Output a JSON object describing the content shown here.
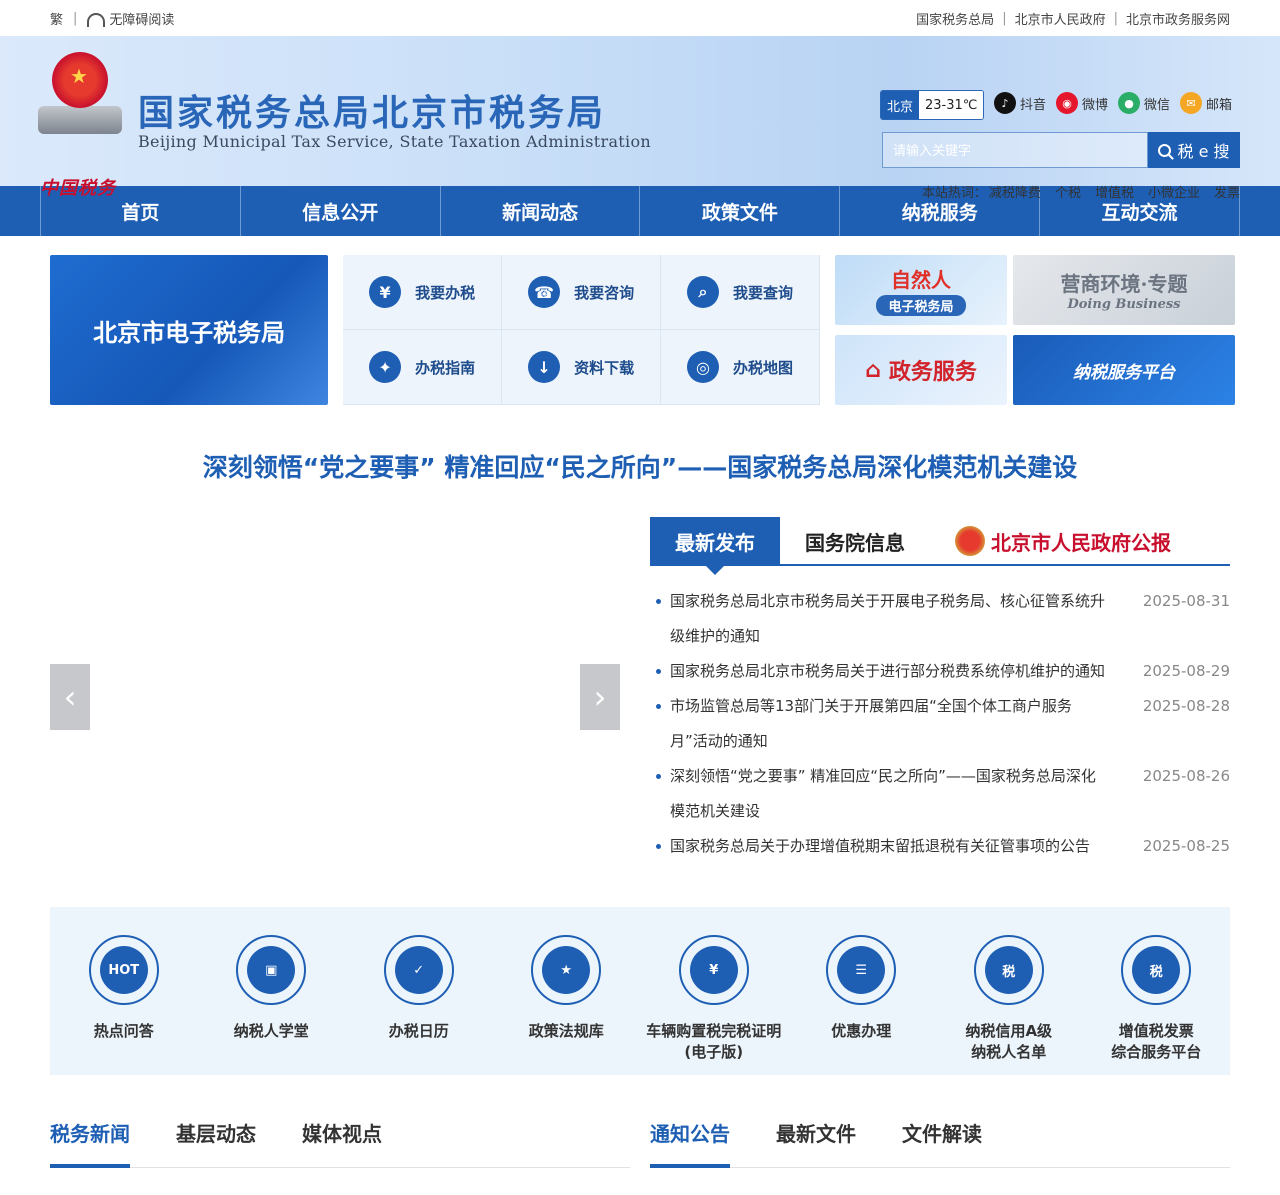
{
  "topbar": {
    "traditional": "繁",
    "accessible": "无障碍阅读",
    "links": [
      "国家税务总局",
      "北京市人民政府",
      "北京市政务服务网"
    ]
  },
  "header": {
    "seal_text": "中国税务",
    "title": "国家税务总局北京市税务局",
    "subtitle": "Beijing Municipal Tax Service, State Taxation Administration",
    "weather_city": "北京",
    "weather_temp": "23-31℃",
    "socials": [
      {
        "label": "抖音",
        "icon": "douyin-icon",
        "color": "#111111",
        "glyph": "♪"
      },
      {
        "label": "微博",
        "icon": "weibo-icon",
        "color": "#e6162d",
        "glyph": "◉"
      },
      {
        "label": "微信",
        "icon": "wechat-icon",
        "color": "#2aae67",
        "glyph": "●"
      },
      {
        "label": "邮箱",
        "icon": "mail-icon",
        "color": "#f5a623",
        "glyph": "✉"
      }
    ],
    "search_placeholder": "请输入关键字",
    "search_button": "税 e 搜",
    "hotwords_label": "本站热词：",
    "hotwords": [
      "减税降费",
      "个税",
      "增值税",
      "小微企业",
      "发票"
    ]
  },
  "nav": [
    "首页",
    "信息公开",
    "新闻动态",
    "政策文件",
    "纳税服务",
    "互动交流"
  ],
  "quick": {
    "etax": "北京市电子税务局",
    "grid": [
      {
        "label": "我要办税",
        "icon": "tax-handling-icon",
        "glyph": "¥"
      },
      {
        "label": "我要咨询",
        "icon": "headset-icon",
        "glyph": "☎"
      },
      {
        "label": "我要查询",
        "icon": "document-search-icon",
        "glyph": "⌕"
      },
      {
        "label": "办税指南",
        "icon": "compass-icon",
        "glyph": "✦"
      },
      {
        "label": "资料下载",
        "icon": "download-icon",
        "glyph": "↓"
      },
      {
        "label": "办税地图",
        "icon": "map-pin-icon",
        "glyph": "◎"
      }
    ],
    "banners": {
      "natural_person": "自然人",
      "natural_person_sub": "电子税务局",
      "business_env": "营商环境·专题",
      "business_env_en": "Doing Business",
      "gov_service": "政务服务",
      "tax_platform": "纳税服务平台"
    }
  },
  "headline": "深刻领悟“党之要事” 精准回应“民之所向”——国家税务总局深化模范机关建设",
  "slider": {
    "prev": "‹",
    "next": "›"
  },
  "news": {
    "tabs": [
      "最新发布",
      "国务院信息",
      "北京市人民政府公报"
    ],
    "items": [
      {
        "title": "国家税务总局北京市税务局关于开展电子税务局、核心征管系统升级维护的通知",
        "date": "2025-08-31"
      },
      {
        "title": "国家税务总局北京市税务局关于进行部分税费系统停机维护的通知",
        "date": "2025-08-29"
      },
      {
        "title": "市场监管总局等13部门关于开展第四届“全国个体工商户服务月”活动的通知",
        "date": "2025-08-28"
      },
      {
        "title": "深刻领悟“党之要事” 精准回应“民之所向”——国家税务总局深化模范机关建设",
        "date": "2025-08-26"
      },
      {
        "title": "国家税务总局关于办理增值税期末留抵退税有关征管事项的公告",
        "date": "2025-08-25"
      }
    ]
  },
  "services": [
    {
      "label": "热点问答",
      "icon": "hot-icon",
      "glyph": "HOT"
    },
    {
      "label": "纳税人学堂",
      "icon": "classroom-icon",
      "glyph": "▣"
    },
    {
      "label": "办税日历",
      "icon": "calendar-icon",
      "glyph": "✓"
    },
    {
      "label": "政策法规库",
      "icon": "law-book-icon",
      "glyph": "★"
    },
    {
      "label": "车辆购置税完税证明\n(电子版)",
      "icon": "car-tax-icon",
      "glyph": "¥"
    },
    {
      "label": "优惠办理",
      "icon": "discount-icon",
      "glyph": "☰"
    },
    {
      "label": "纳税信用A级\n纳税人名单",
      "icon": "credit-icon",
      "glyph": "税"
    },
    {
      "label": "增值税发票\n综合服务平台",
      "icon": "invoice-icon",
      "glyph": "税"
    }
  ],
  "bottom_tabs_left": [
    "税务新闻",
    "基层动态",
    "媒体视点"
  ],
  "bottom_tabs_right": [
    "通知公告",
    "最新文件",
    "文件解读"
  ]
}
